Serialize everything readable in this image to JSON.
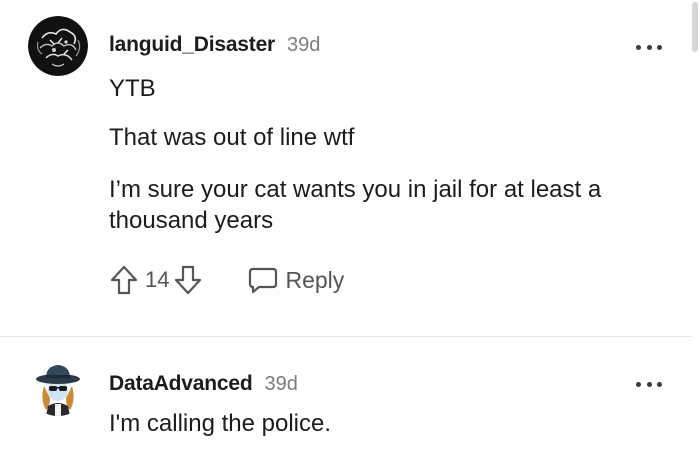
{
  "comments": [
    {
      "username": "languid_Disaster",
      "timestamp": "39d",
      "avatar_icon": "dark-abstract-avatar",
      "body": [
        "YTB",
        "That was out of line wtf",
        "I’m sure your cat wants you in jail for at least a thousand years"
      ],
      "vote_count": "14",
      "reply_label": "Reply"
    },
    {
      "username": "DataAdvanced",
      "timestamp": "39d",
      "avatar_icon": "detective-character-avatar",
      "body": [
        "I'm calling the police."
      ]
    }
  ],
  "icons": {
    "upvote": "arrow-up-icon",
    "downvote": "arrow-down-icon",
    "reply": "speech-bubble-icon",
    "more": "more-horizontal-icon"
  },
  "colors": {
    "text": "#1c1c1c",
    "meta": "#7c7c7c",
    "action": "#555555",
    "divider": "#e6e6e6"
  }
}
